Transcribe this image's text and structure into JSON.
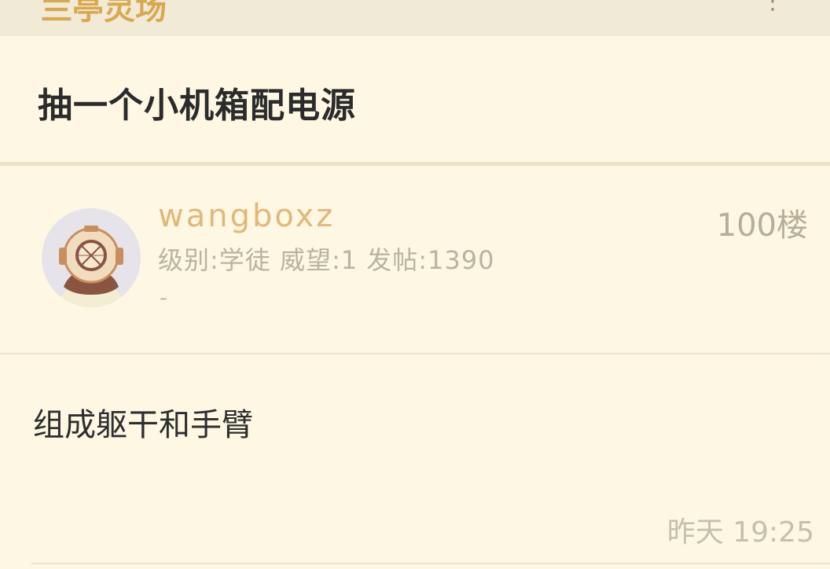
{
  "header": {
    "title": "兰亭灵场",
    "more_icon": "more-icon"
  },
  "thread": {
    "title": "抽一个小机箱配电源"
  },
  "post": {
    "avatar_icon": "diving-helmet-avatar-icon",
    "username": "wangboxz",
    "meta": "级别:学徒 威望:1 发帖:1390",
    "signature": "-",
    "floor": "100楼",
    "content": "组成躯干和手臂",
    "time": "昨天 19:25"
  },
  "colors": {
    "background": "#fdf7e3",
    "topbar": "#f1ead7",
    "accent": "#d9a94f",
    "username": "#e2b878",
    "muted": "#b9b3a1"
  }
}
